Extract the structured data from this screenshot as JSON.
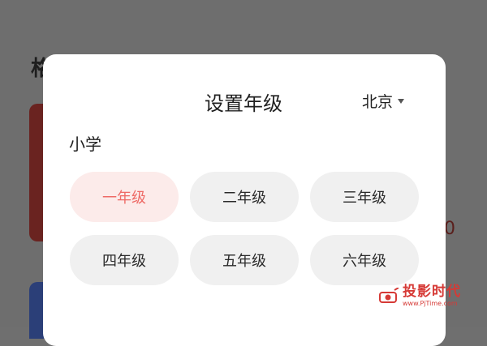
{
  "background": {
    "title_fragment": "格",
    "number_fragment": "0"
  },
  "modal": {
    "title": "设置年级",
    "region": "北京",
    "section_label": "小学",
    "grades": [
      {
        "label": "一年级",
        "selected": true
      },
      {
        "label": "二年级",
        "selected": false
      },
      {
        "label": "三年级",
        "selected": false
      },
      {
        "label": "四年级",
        "selected": false
      },
      {
        "label": "五年级",
        "selected": false
      },
      {
        "label": "六年级",
        "selected": false
      }
    ]
  },
  "watermark": {
    "name": "投影时代",
    "url": "www.PjTime.com"
  },
  "colors": {
    "accent": "#ee6a66",
    "selected_bg": "#fcebea",
    "chip_bg": "#f0f0f0",
    "overlay": "#6e6e6e"
  }
}
